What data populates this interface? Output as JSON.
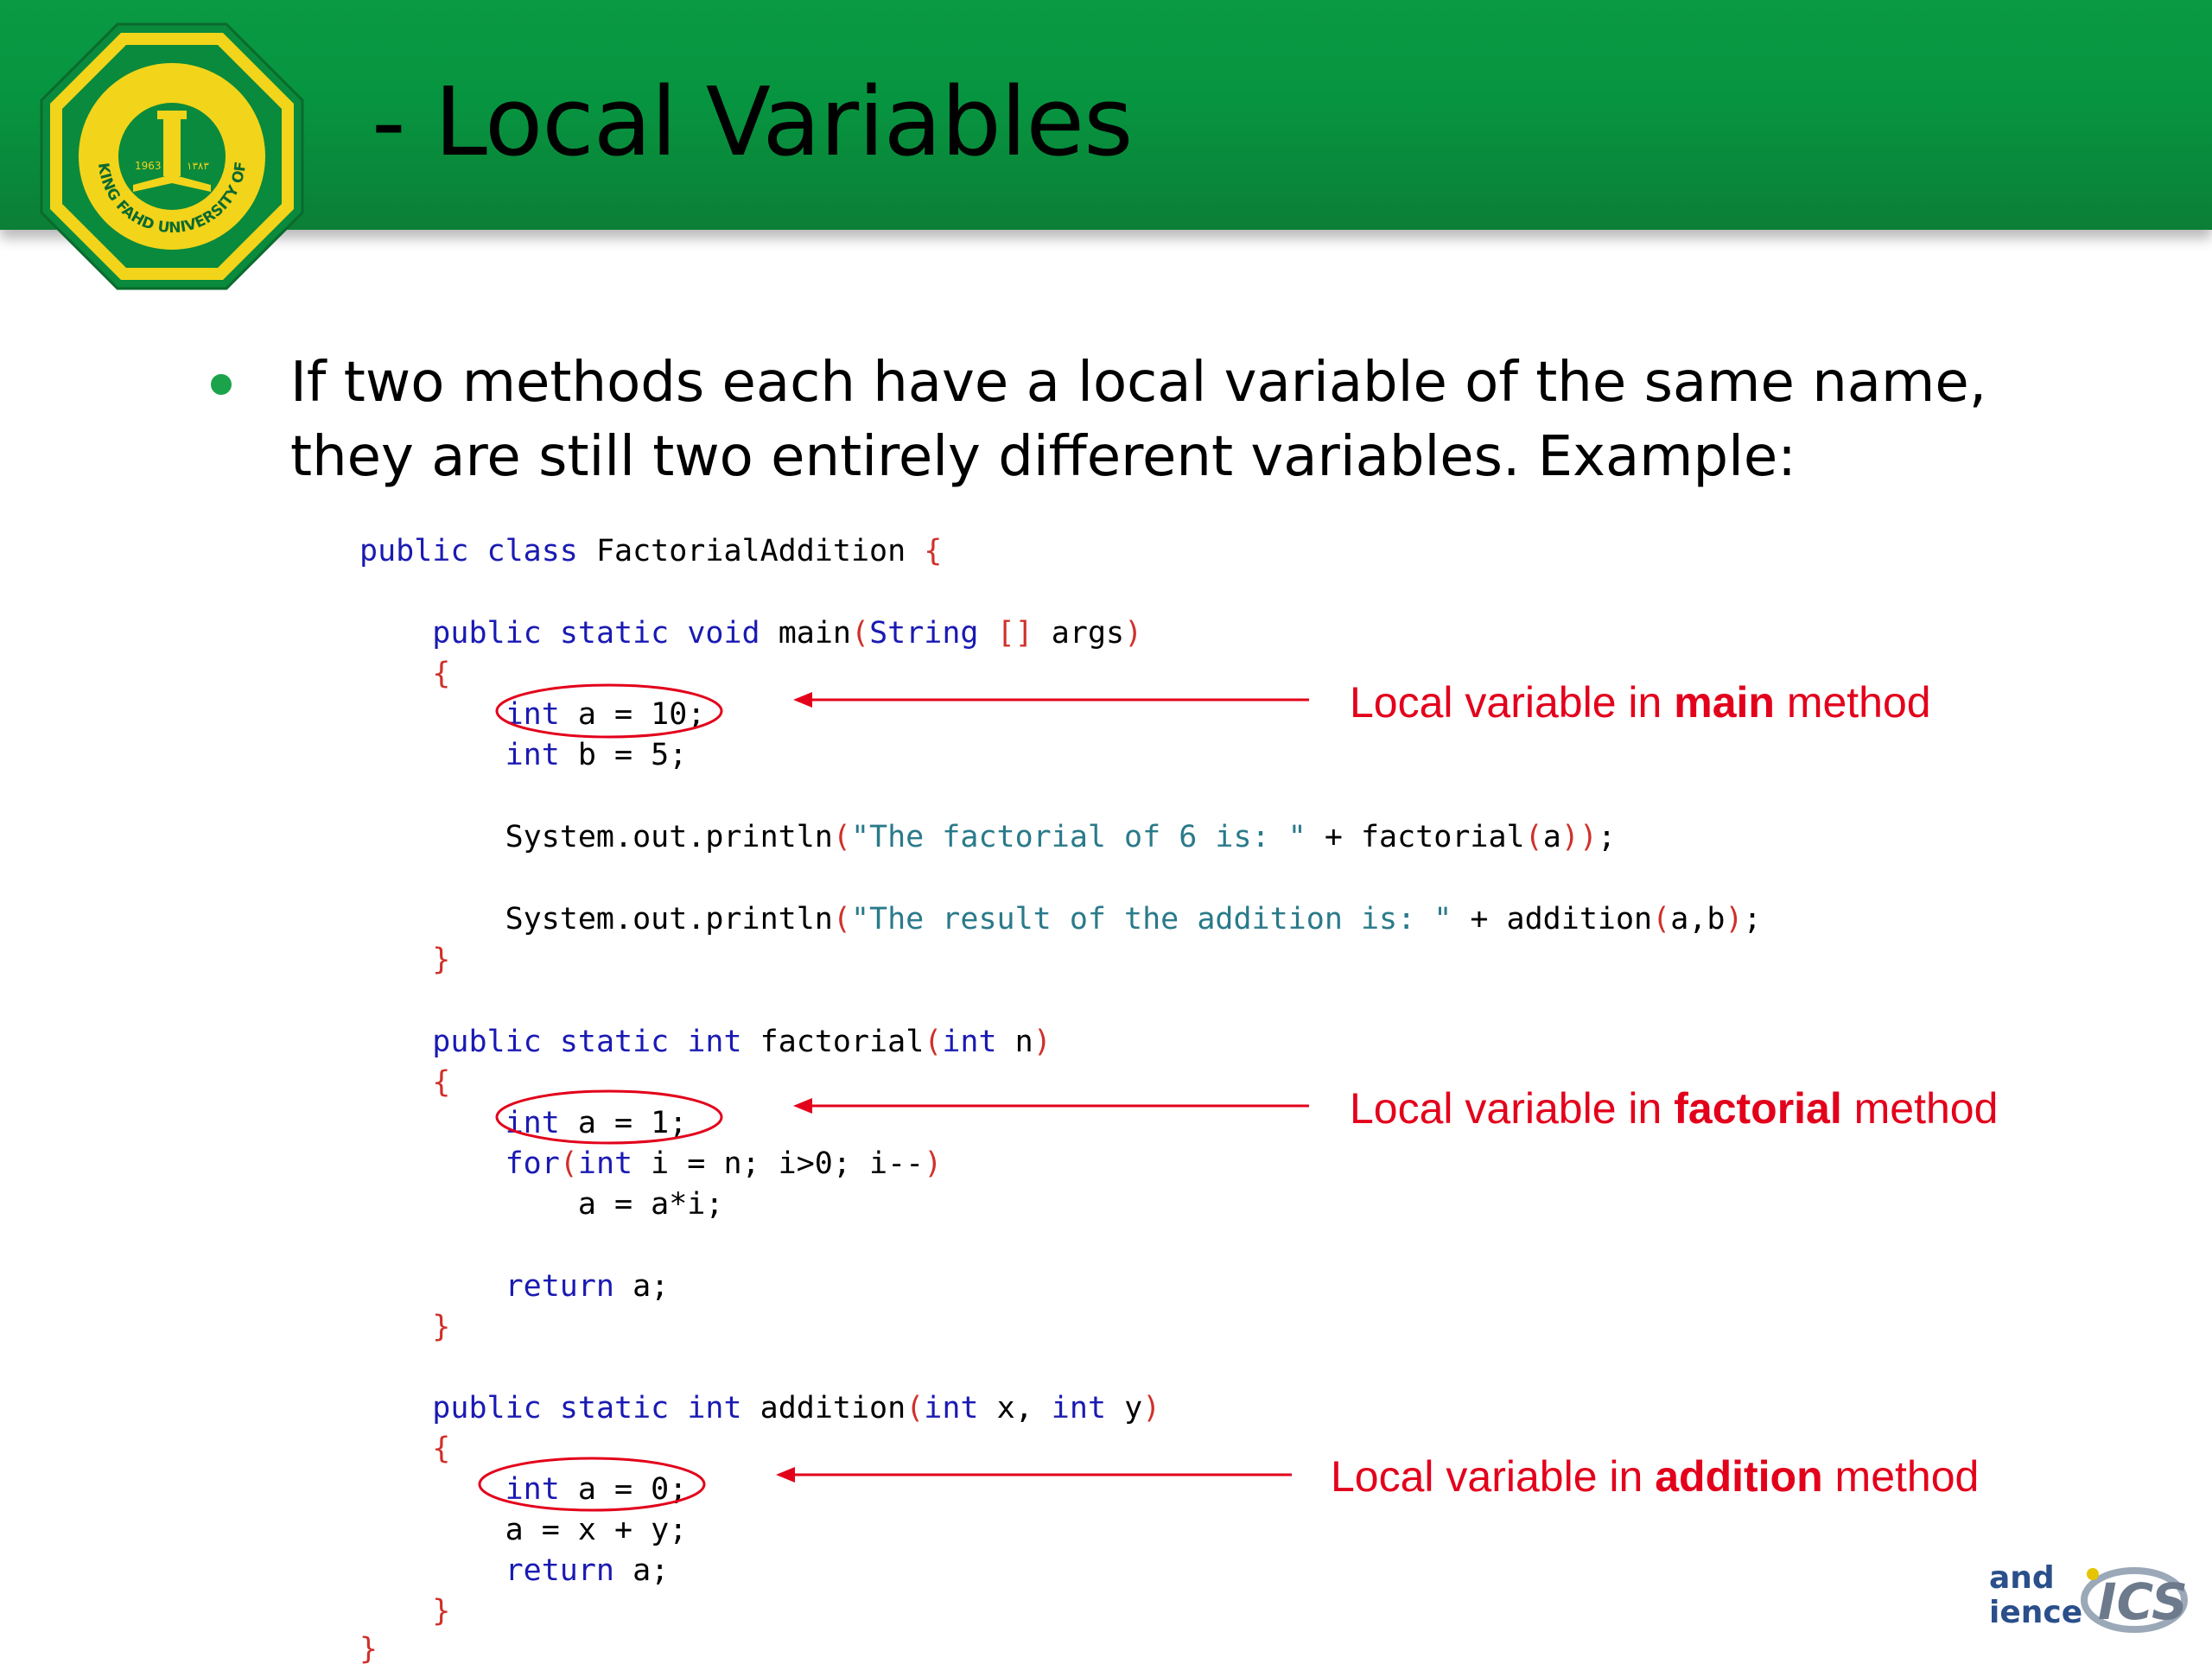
{
  "slide": {
    "title": "- Local Variables",
    "bullet": "If two methods each have a local variable of the same name, they are still two entirely different variables. Example:"
  },
  "logo": {
    "name": "KING FAHD UNIVERSITY OF PETROLEUM & MINERALS",
    "year_left": "1963",
    "year_right": "١٣٨٣"
  },
  "code": {
    "lines": [
      "public class FactorialAddition {",
      "    public static void main(String [] args)",
      "    {",
      "        int a = 10;",
      "        int b = 5;",
      "        System.out.println(\"The factorial of 6 is: \" + factorial(a));",
      "        System.out.println(\"The result of the addition is: \" + addition(a,b);",
      "    }",
      "    public static int factorial(int n)",
      "    {",
      "        int a = 1;",
      "        for(int i = n; i>0; i--)",
      "            a = a*i;",
      "        return a;",
      "    }",
      "    public static int addition(int x, int y)",
      "    {",
      "        int a = 0;",
      "        a = x + y;",
      "        return a;",
      "    }",
      "}"
    ]
  },
  "annotations": [
    {
      "prefix": "Local variable in ",
      "bold": "main",
      "suffix": " method"
    },
    {
      "prefix": "Local variable in ",
      "bold": "factorial",
      "suffix": " method"
    },
    {
      "prefix": "Local variable in ",
      "bold": "addition",
      "suffix": " method"
    }
  ],
  "corner_logo": {
    "text_top": "and",
    "text_bottom": "ience",
    "mark": "ICS"
  },
  "colors": {
    "header_green": "#079440",
    "bullet_green": "#1aa34a",
    "annotation_red": "#e3001b",
    "keyword_blue": "#1a1ab3",
    "string_teal": "#2a7a8a",
    "brace_red": "#d0302a",
    "logo_gold": "#f2d41a"
  }
}
